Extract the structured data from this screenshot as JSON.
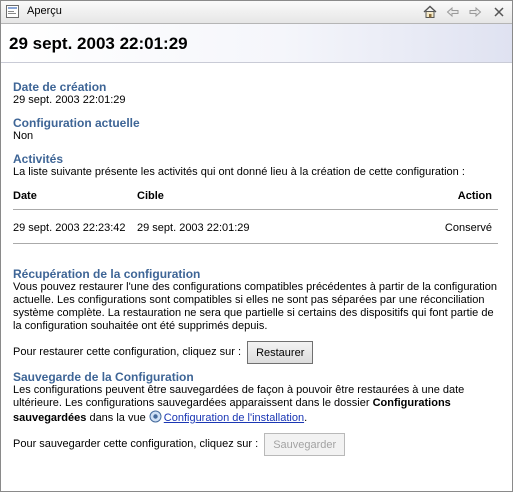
{
  "window": {
    "tab_title": "Aperçu"
  },
  "header": {
    "title": "29 sept. 2003 22:01:29"
  },
  "creation": {
    "heading": "Date de création",
    "value": "29 sept. 2003 22:01:29"
  },
  "current_config": {
    "heading": "Configuration actuelle",
    "value": "Non"
  },
  "activities": {
    "heading": "Activités",
    "description": "La liste suivante présente les activités qui ont donné lieu à la création de cette configuration :",
    "columns": [
      "Date",
      "Cible",
      "Action"
    ],
    "rows": [
      {
        "date": "29 sept. 2003 22:23:42",
        "target": "29 sept. 2003 22:01:29",
        "action": "Conservé"
      }
    ]
  },
  "recovery": {
    "heading": "Récupération de la configuration",
    "text": "Vous pouvez restaurer l'une des configurations compatibles précédentes à partir de la configuration actuelle. Les configurations sont compatibles si elles ne sont pas séparées par une réconciliation système complète. La restauration ne sera que partielle si certains des dispositifs qui font partie de la configuration souhaitée ont été supprimés depuis.",
    "prompt": "Pour restaurer cette configuration, cliquez sur :",
    "button": "Restaurer"
  },
  "backup": {
    "heading": "Sauvegarde de la Configuration",
    "text_start": "Les configurations peuvent être sauvegardées de façon à pouvoir être restaurées à une date ultérieure. Les configurations sauvegardées apparaissent dans le dossier ",
    "text_bold": "Configurations sauvegardées",
    "text_mid": " dans la vue ",
    "link": "Configuration de l'installation",
    "text_end": ".",
    "prompt": "Pour sauvegarder cette configuration, cliquez sur :",
    "button": "Sauvegarder"
  },
  "icons": {
    "app": "preview-icon",
    "home": "home-icon",
    "back": "back-arrow-icon",
    "forward": "forward-arrow-icon",
    "close": "close-icon",
    "link": "install-config-icon"
  },
  "colors": {
    "heading": "#3e6596",
    "link": "#1a36b4"
  }
}
